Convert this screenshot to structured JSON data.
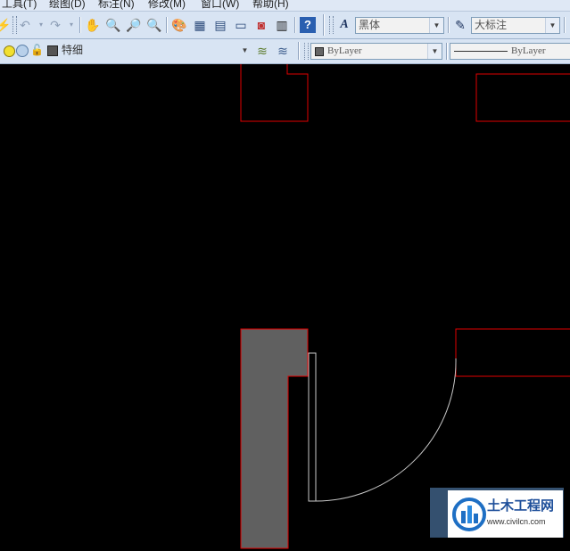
{
  "menu": [
    {
      "label": "工具(T)"
    },
    {
      "label": "绘图(D)"
    },
    {
      "label": "标注(N)"
    },
    {
      "label": "修改(M)"
    },
    {
      "label": "窗口(W)"
    },
    {
      "label": "帮助(H)"
    }
  ],
  "toolbar": {
    "text_style": "黑体",
    "dim_style": "大标注"
  },
  "layers": {
    "current_layer": "特细",
    "color_value": "ByLayer",
    "linetype_value": "ByLayer"
  },
  "colors": {
    "toolbar_bg": "#d8e4f3",
    "canvas_bg": "#000000",
    "wall_outline": "#ff0000",
    "wall_fill": "#606060",
    "door_line": "#c8c8c8"
  },
  "watermark": {
    "title": "土木工程网",
    "url": "www.civilcn.com"
  }
}
